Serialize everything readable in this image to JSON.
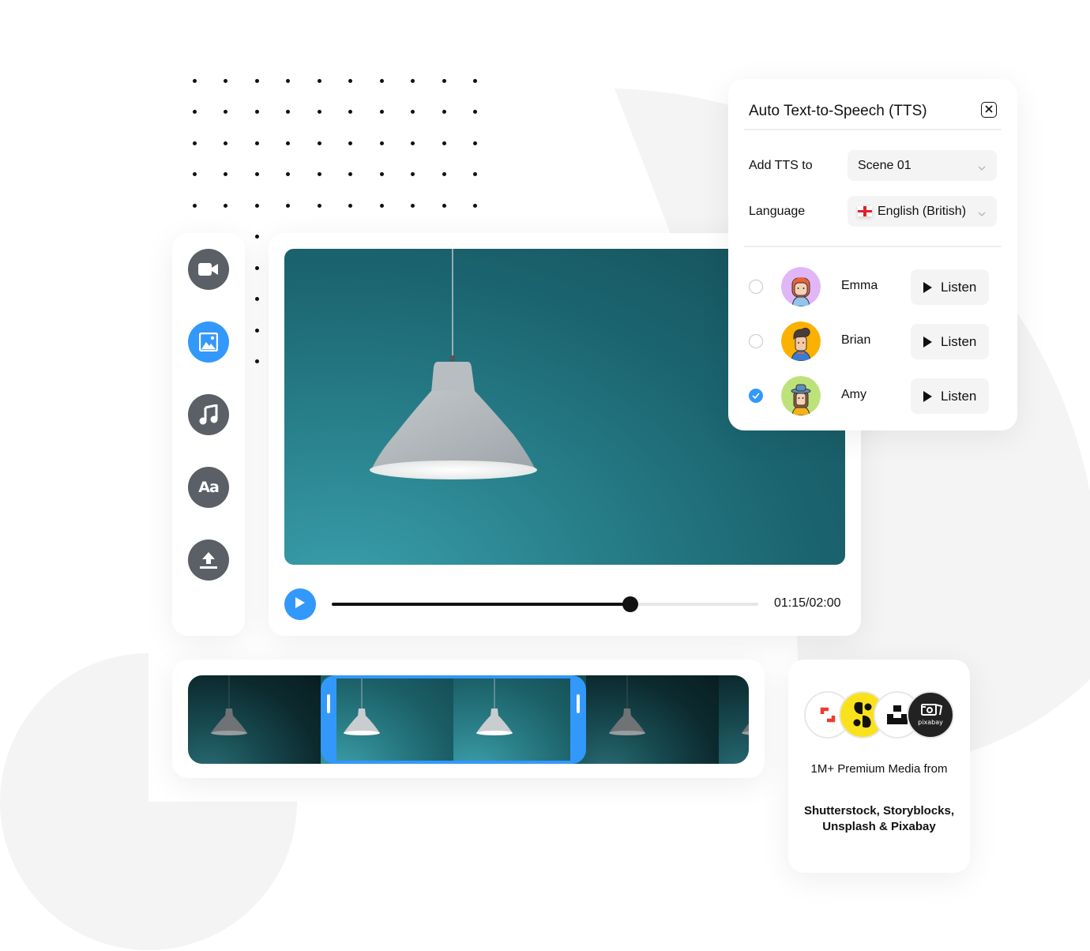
{
  "colors": {
    "accent": "#3398fb",
    "tool_icon_bg": "#5b5f66",
    "text": "#111111",
    "field_bg": "#f4f4f4",
    "background_shape": "#f4f4f4"
  },
  "sidebar": {
    "tools": [
      {
        "name": "video",
        "icon": "video-camera-icon",
        "active": false
      },
      {
        "name": "image",
        "icon": "image-icon",
        "active": true
      },
      {
        "name": "music",
        "icon": "music-note-icon",
        "active": false
      },
      {
        "name": "text",
        "icon": "text-icon",
        "label": "Aa",
        "active": false
      },
      {
        "name": "upload",
        "icon": "upload-icon",
        "active": false
      }
    ]
  },
  "player": {
    "current_time": "01:15",
    "total_time": "02:00",
    "time_display": "01:15/02:00",
    "progress": 0.7,
    "play_icon": "play-icon"
  },
  "tts": {
    "title": "Auto Text-to-Speech (TTS)",
    "close_icon": "close-icon",
    "add_to_label": "Add TTS to",
    "add_to_value": "Scene 01",
    "language_label": "Language",
    "language_value": "English (British)",
    "language_flag": "england-flag-icon",
    "voices": [
      {
        "name": "Emma",
        "selected": false,
        "listen_label": "Listen",
        "avatar_bg": "#e0b6f7"
      },
      {
        "name": "Brian",
        "selected": false,
        "listen_label": "Listen",
        "avatar_bg": "#fbb102"
      },
      {
        "name": "Amy",
        "selected": true,
        "listen_label": "Listen",
        "avatar_bg": "#bde27a"
      }
    ]
  },
  "timeline": {
    "frames": 5,
    "selected_frames": [
      1,
      2
    ]
  },
  "media": {
    "logos": [
      {
        "name": "shutterstock",
        "icon": "shutterstock-logo-icon"
      },
      {
        "name": "storyblocks",
        "icon": "storyblocks-logo-icon"
      },
      {
        "name": "unsplash",
        "icon": "unsplash-logo-icon"
      },
      {
        "name": "pixabay",
        "icon": "pixabay-logo-icon",
        "label": "pixabay"
      }
    ],
    "subtitle": "1M+ Premium Media from",
    "brands": "Shutterstock, Storyblocks, Unsplash & Pixabay"
  }
}
